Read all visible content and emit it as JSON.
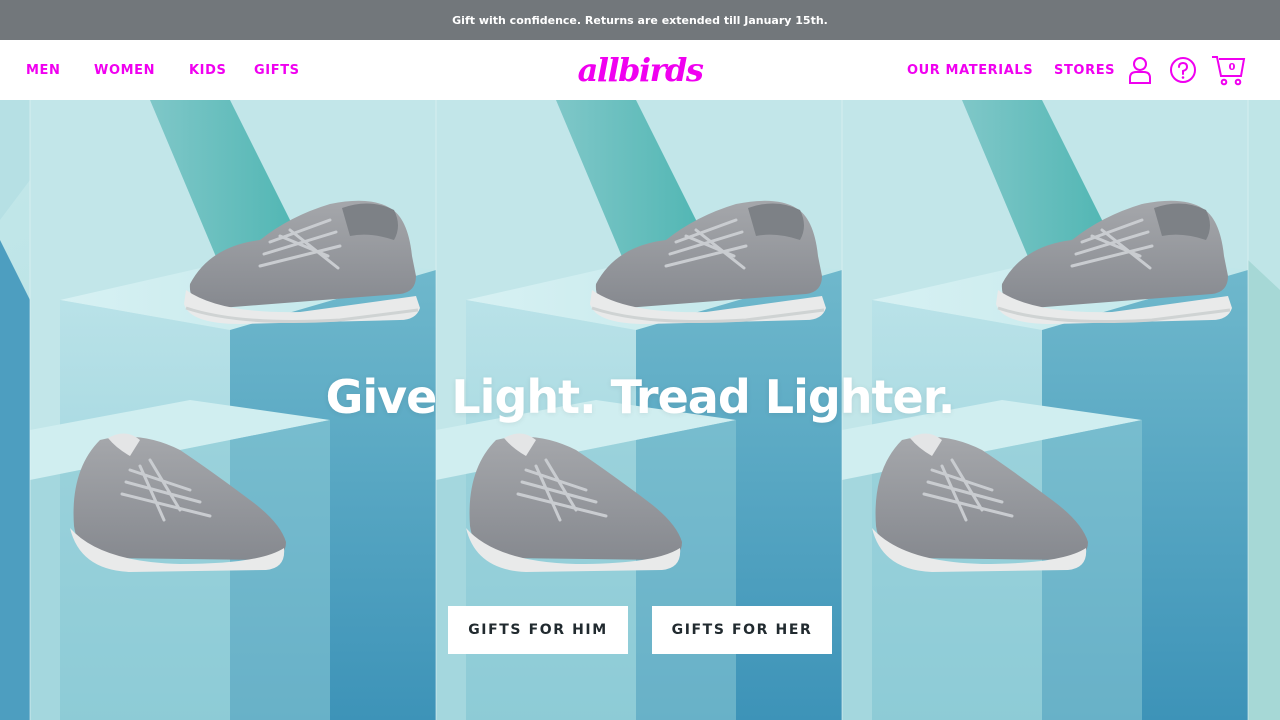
{
  "brand": {
    "accent_color": "#f000f0",
    "promo_bg": "#72777b",
    "text_dark": "#212a2f"
  },
  "promo": {
    "text": "Gift with confidence. Returns are extended till January 15th."
  },
  "header": {
    "logo_text": "allbirds",
    "nav_left": [
      {
        "label": "MEN"
      },
      {
        "label": "WOMEN"
      },
      {
        "label": "KIDS"
      },
      {
        "label": "GIFTS"
      }
    ],
    "nav_right": [
      {
        "label": "OUR MATERIALS"
      },
      {
        "label": "STORES"
      }
    ],
    "icons": {
      "account": "user-icon",
      "help": "question-circle-icon",
      "cart": "cart-icon"
    },
    "cart_count": "0"
  },
  "hero": {
    "title": "Give Light. Tread Lighter.",
    "buttons": [
      {
        "label": "GIFTS FOR HIM"
      },
      {
        "label": "GIFTS FOR HER"
      }
    ]
  }
}
